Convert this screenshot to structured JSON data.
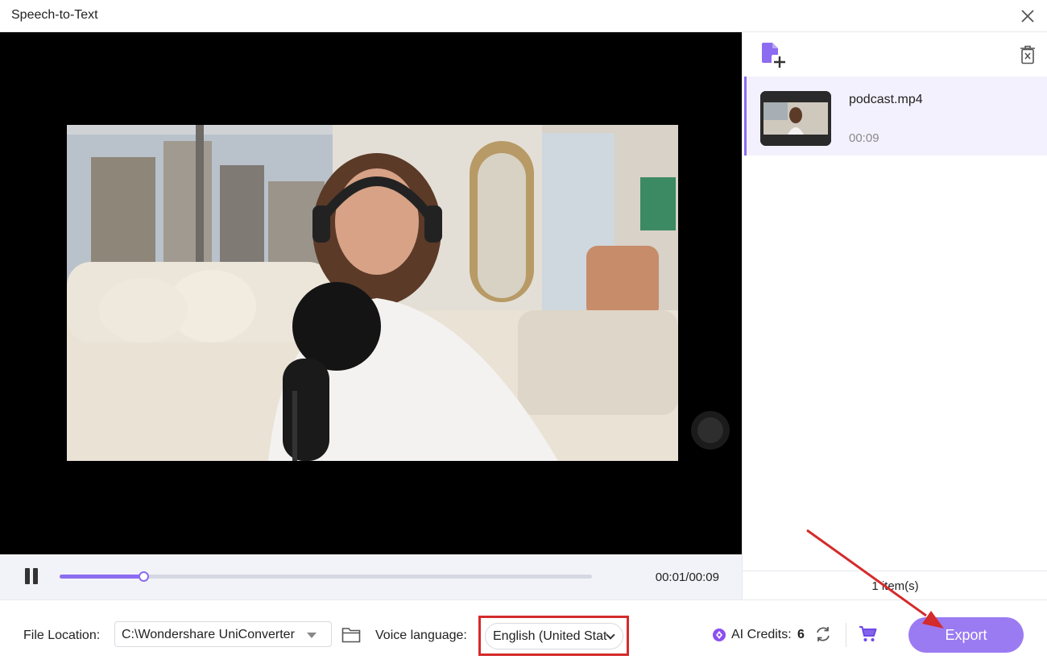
{
  "window": {
    "title": "Speech-to-Text",
    "close_icon": "close-icon"
  },
  "player": {
    "current_time": "00:01/00:09",
    "progress_fraction": 0.157,
    "pause_icon": "pause-icon"
  },
  "sidebar": {
    "add_icon": "add-file-icon",
    "delete_icon": "delete-icon",
    "files": [
      {
        "name": "podcast.mp4",
        "duration": "00:09"
      }
    ],
    "item_count": "1 item(s)"
  },
  "footer": {
    "file_location_label": "File Location:",
    "file_location_value": "C:\\Wondershare UniConverter",
    "voice_language_label": "Voice language:",
    "voice_language_value": "English (United Stat",
    "ai_credits_label": "AI Credits:",
    "ai_credits_value": "6",
    "export_label": "Export"
  },
  "colors": {
    "accent": "#8c6cf0",
    "export_button": "#9b7bf2",
    "highlight_box": "#d42b2b",
    "annotation_arrow": "#d42b2b"
  }
}
